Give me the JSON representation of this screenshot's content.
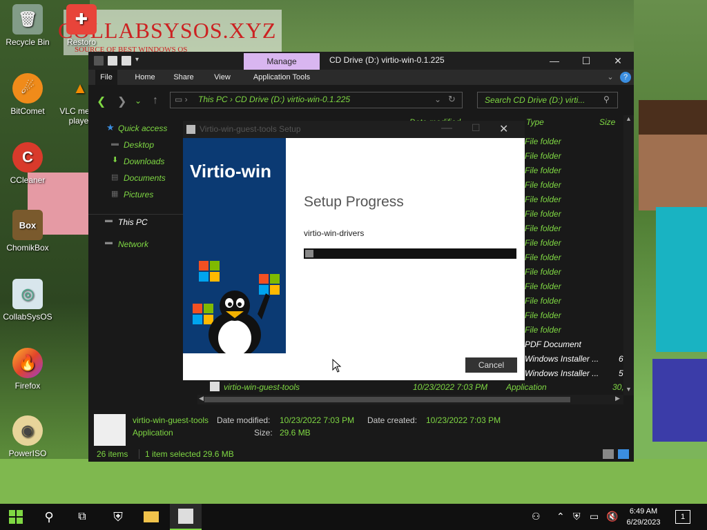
{
  "desktop": {
    "banner_title": "COLLABSYSOS.XYZ",
    "banner_subtitle": "SOURCE OF BEST WINDOWS OS",
    "icons": [
      {
        "label": "Recycle Bin"
      },
      {
        "label": "Restoro"
      },
      {
        "label": "BitComet"
      },
      {
        "label": "VLC media player"
      },
      {
        "label": "CCleaner"
      },
      {
        "label": "ChomikBox"
      },
      {
        "label": "CollabSysOS"
      },
      {
        "label": "Firefox"
      },
      {
        "label": "PowerISO"
      }
    ]
  },
  "explorer": {
    "manage_tab": "Manage",
    "title": "CD Drive (D:) virtio-win-0.1.225",
    "ribbon_tabs": [
      "File",
      "Home",
      "Share",
      "View",
      "Application Tools"
    ],
    "address": {
      "this_pc": "This PC",
      "sep": "›",
      "drive": "CD Drive (D:) virtio-win-0.1.225"
    },
    "search_placeholder": "Search CD Drive (D:) virti...",
    "nav": {
      "quick_access": "Quick access",
      "desktop": "Desktop",
      "downloads": "Downloads",
      "documents": "Documents",
      "pictures": "Pictures",
      "this_pc": "This PC",
      "network": "Network"
    },
    "columns": {
      "date_modified": "Date modified",
      "type": "Type",
      "size": "Size"
    },
    "rows": [
      {
        "type": "File folder",
        "size": ""
      },
      {
        "type": "File folder",
        "size": ""
      },
      {
        "type": "File folder",
        "size": ""
      },
      {
        "type": "File folder",
        "size": ""
      },
      {
        "type": "File folder",
        "size": ""
      },
      {
        "type": "File folder",
        "size": ""
      },
      {
        "type": "File folder",
        "size": ""
      },
      {
        "type": "File folder",
        "size": ""
      },
      {
        "type": "File folder",
        "size": ""
      },
      {
        "type": "File folder",
        "size": ""
      },
      {
        "type": "File folder",
        "size": ""
      },
      {
        "type": "File folder",
        "size": ""
      },
      {
        "type": "File folder",
        "size": ""
      },
      {
        "type": "File folder",
        "size": ""
      },
      {
        "type": "PDF Document",
        "size": ""
      },
      {
        "type": "Windows Installer ...",
        "size": "6,"
      },
      {
        "type": "Windows Installer ...",
        "size": "5"
      }
    ],
    "selected": {
      "name": "virtio-win-guest-tools",
      "date": "10/23/2022 7:03 PM",
      "type": "Application",
      "size": "30,"
    },
    "details": {
      "name": "virtio-win-guest-tools",
      "date_modified_label": "Date modified:",
      "date_modified": "10/23/2022 7:03 PM",
      "date_created_label": "Date created:",
      "date_created": "10/23/2022 7:03 PM",
      "type": "Application",
      "size_label": "Size:",
      "size": "29.6 MB"
    },
    "status": {
      "items": "26 items",
      "selected": "1 item selected  29.6 MB"
    }
  },
  "setup": {
    "title": "Virtio-win-guest-tools Setup",
    "side_title": "Virtio-win",
    "heading": "Setup Progress",
    "current_item": "virtio-win-drivers",
    "progress_percent": 4,
    "cancel_label": "Cancel"
  },
  "taskbar": {
    "time": "6:49 AM",
    "date": "6/29/2023",
    "notification_count": "1"
  },
  "colors": {
    "accent_green": "#7fd843",
    "manage_tab": "#d9b6f0",
    "setup_side": "#0b3a73"
  }
}
